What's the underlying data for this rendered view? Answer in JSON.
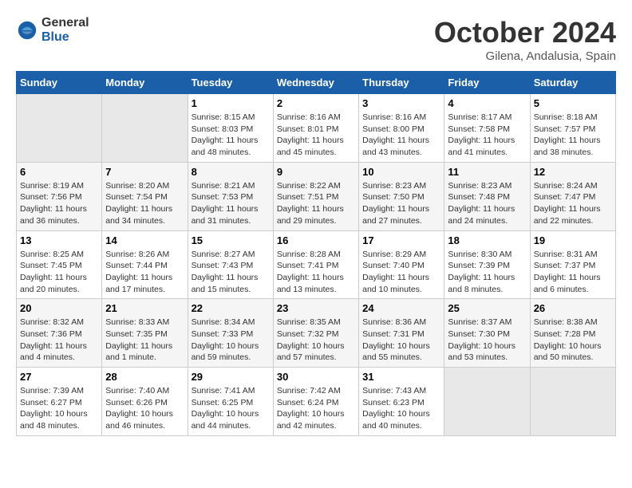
{
  "logo": {
    "general": "General",
    "blue": "Blue"
  },
  "title": {
    "month": "October 2024",
    "location": "Gilena, Andalusia, Spain"
  },
  "headers": [
    "Sunday",
    "Monday",
    "Tuesday",
    "Wednesday",
    "Thursday",
    "Friday",
    "Saturday"
  ],
  "weeks": [
    [
      {
        "day": "",
        "info": ""
      },
      {
        "day": "",
        "info": ""
      },
      {
        "day": "1",
        "info": "Sunrise: 8:15 AM\nSunset: 8:03 PM\nDaylight: 11 hours and 48 minutes."
      },
      {
        "day": "2",
        "info": "Sunrise: 8:16 AM\nSunset: 8:01 PM\nDaylight: 11 hours and 45 minutes."
      },
      {
        "day": "3",
        "info": "Sunrise: 8:16 AM\nSunset: 8:00 PM\nDaylight: 11 hours and 43 minutes."
      },
      {
        "day": "4",
        "info": "Sunrise: 8:17 AM\nSunset: 7:58 PM\nDaylight: 11 hours and 41 minutes."
      },
      {
        "day": "5",
        "info": "Sunrise: 8:18 AM\nSunset: 7:57 PM\nDaylight: 11 hours and 38 minutes."
      }
    ],
    [
      {
        "day": "6",
        "info": "Sunrise: 8:19 AM\nSunset: 7:56 PM\nDaylight: 11 hours and 36 minutes."
      },
      {
        "day": "7",
        "info": "Sunrise: 8:20 AM\nSunset: 7:54 PM\nDaylight: 11 hours and 34 minutes."
      },
      {
        "day": "8",
        "info": "Sunrise: 8:21 AM\nSunset: 7:53 PM\nDaylight: 11 hours and 31 minutes."
      },
      {
        "day": "9",
        "info": "Sunrise: 8:22 AM\nSunset: 7:51 PM\nDaylight: 11 hours and 29 minutes."
      },
      {
        "day": "10",
        "info": "Sunrise: 8:23 AM\nSunset: 7:50 PM\nDaylight: 11 hours and 27 minutes."
      },
      {
        "day": "11",
        "info": "Sunrise: 8:23 AM\nSunset: 7:48 PM\nDaylight: 11 hours and 24 minutes."
      },
      {
        "day": "12",
        "info": "Sunrise: 8:24 AM\nSunset: 7:47 PM\nDaylight: 11 hours and 22 minutes."
      }
    ],
    [
      {
        "day": "13",
        "info": "Sunrise: 8:25 AM\nSunset: 7:45 PM\nDaylight: 11 hours and 20 minutes."
      },
      {
        "day": "14",
        "info": "Sunrise: 8:26 AM\nSunset: 7:44 PM\nDaylight: 11 hours and 17 minutes."
      },
      {
        "day": "15",
        "info": "Sunrise: 8:27 AM\nSunset: 7:43 PM\nDaylight: 11 hours and 15 minutes."
      },
      {
        "day": "16",
        "info": "Sunrise: 8:28 AM\nSunset: 7:41 PM\nDaylight: 11 hours and 13 minutes."
      },
      {
        "day": "17",
        "info": "Sunrise: 8:29 AM\nSunset: 7:40 PM\nDaylight: 11 hours and 10 minutes."
      },
      {
        "day": "18",
        "info": "Sunrise: 8:30 AM\nSunset: 7:39 PM\nDaylight: 11 hours and 8 minutes."
      },
      {
        "day": "19",
        "info": "Sunrise: 8:31 AM\nSunset: 7:37 PM\nDaylight: 11 hours and 6 minutes."
      }
    ],
    [
      {
        "day": "20",
        "info": "Sunrise: 8:32 AM\nSunset: 7:36 PM\nDaylight: 11 hours and 4 minutes."
      },
      {
        "day": "21",
        "info": "Sunrise: 8:33 AM\nSunset: 7:35 PM\nDaylight: 11 hours and 1 minute."
      },
      {
        "day": "22",
        "info": "Sunrise: 8:34 AM\nSunset: 7:33 PM\nDaylight: 10 hours and 59 minutes."
      },
      {
        "day": "23",
        "info": "Sunrise: 8:35 AM\nSunset: 7:32 PM\nDaylight: 10 hours and 57 minutes."
      },
      {
        "day": "24",
        "info": "Sunrise: 8:36 AM\nSunset: 7:31 PM\nDaylight: 10 hours and 55 minutes."
      },
      {
        "day": "25",
        "info": "Sunrise: 8:37 AM\nSunset: 7:30 PM\nDaylight: 10 hours and 53 minutes."
      },
      {
        "day": "26",
        "info": "Sunrise: 8:38 AM\nSunset: 7:28 PM\nDaylight: 10 hours and 50 minutes."
      }
    ],
    [
      {
        "day": "27",
        "info": "Sunrise: 7:39 AM\nSunset: 6:27 PM\nDaylight: 10 hours and 48 minutes."
      },
      {
        "day": "28",
        "info": "Sunrise: 7:40 AM\nSunset: 6:26 PM\nDaylight: 10 hours and 46 minutes."
      },
      {
        "day": "29",
        "info": "Sunrise: 7:41 AM\nSunset: 6:25 PM\nDaylight: 10 hours and 44 minutes."
      },
      {
        "day": "30",
        "info": "Sunrise: 7:42 AM\nSunset: 6:24 PM\nDaylight: 10 hours and 42 minutes."
      },
      {
        "day": "31",
        "info": "Sunrise: 7:43 AM\nSunset: 6:23 PM\nDaylight: 10 hours and 40 minutes."
      },
      {
        "day": "",
        "info": ""
      },
      {
        "day": "",
        "info": ""
      }
    ]
  ]
}
